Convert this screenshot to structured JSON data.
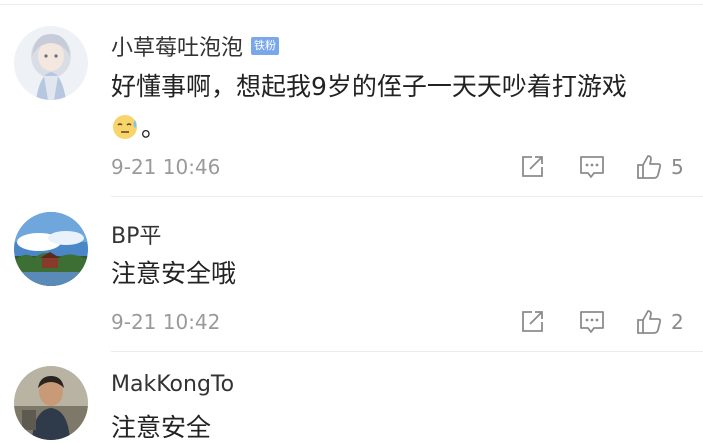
{
  "comments": [
    {
      "username": "小草莓吐泡泡",
      "badge": "铁粉",
      "text_line1": "好懂事啊，想起我9岁的侄子一天天吵着打游戏",
      "text_line2": "。",
      "emoji": "sweat-face-emoji",
      "timestamp": "9-21 10:46",
      "likes": "5",
      "avatar": "anime-girl-avatar"
    },
    {
      "username": "BP平",
      "text": "注意安全哦",
      "timestamp": "9-21 10:42",
      "likes": "2",
      "avatar": "landscape-avatar"
    },
    {
      "username": "MakKongTo",
      "text": "注意安全",
      "avatar": "boy-photo-avatar"
    }
  ],
  "icons": {
    "share": "share-icon",
    "comment": "comment-icon",
    "like": "thumbs-up-icon"
  },
  "colors": {
    "badge": "#7aa7ea",
    "username": "#333333",
    "meta": "#9a9a9a",
    "icon": "#8c8c8c"
  }
}
